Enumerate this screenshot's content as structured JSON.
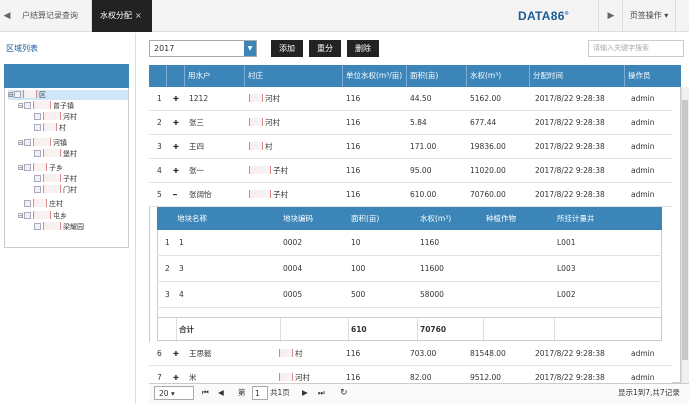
{
  "tabs": {
    "prev_arrow": "◀",
    "next_arrow": "▶",
    "items": [
      {
        "label": "户结算记录查询"
      },
      {
        "label": "水权分配",
        "close": "×"
      }
    ],
    "logo": "DATA86",
    "logo_mark": "®",
    "page_ops": "页签操作"
  },
  "left": {
    "title": "区域列表",
    "tree": [
      {
        "label": "区",
        "level": 0,
        "toggle": "⊟"
      },
      {
        "label": "曾子镇",
        "level": 1,
        "toggle": "⊟"
      },
      {
        "label": "河村",
        "level": 2,
        "toggle": ""
      },
      {
        "label": "村",
        "level": 2,
        "toggle": ""
      },
      {
        "label": "河镇",
        "level": 1,
        "toggle": "⊟"
      },
      {
        "label": "堡村",
        "level": 2,
        "toggle": ""
      },
      {
        "label": "子乡",
        "level": 1,
        "toggle": "⊟"
      },
      {
        "label": "子村",
        "level": 2,
        "toggle": ""
      },
      {
        "label": "门村",
        "level": 2,
        "toggle": ""
      },
      {
        "label": "庄村",
        "level": 1,
        "toggle": ""
      },
      {
        "label": "屯乡",
        "level": 1,
        "toggle": "⊟"
      },
      {
        "label": "梁耀园",
        "level": 2,
        "toggle": ""
      }
    ]
  },
  "toolbar": {
    "year": "2017",
    "add": "添加",
    "split": "重分",
    "delete": "删除",
    "search_placeholder": "请输入关键字搜索"
  },
  "grid": {
    "columns": [
      "用水户",
      "村庄",
      "单位水权(m³/亩)",
      "面积(亩)",
      "水权(m³)",
      "分配时间",
      "操作员"
    ],
    "rows": [
      {
        "no": "1",
        "exp": "✚",
        "user": "1212",
        "village": "河村",
        "unit": "116",
        "area": "44.50",
        "water": "5162.00",
        "time": "2017/8/22 9:28:38",
        "op": "admin"
      },
      {
        "no": "2",
        "exp": "✚",
        "user": "张三",
        "village": "河村",
        "unit": "116",
        "area": "5.84",
        "water": "677.44",
        "time": "2017/8/22 9:28:38",
        "op": "admin"
      },
      {
        "no": "3",
        "exp": "✚",
        "user": "王四",
        "village": "村",
        "unit": "116",
        "area": "171.00",
        "water": "19836.00",
        "time": "2017/8/22 9:28:38",
        "op": "admin"
      },
      {
        "no": "4",
        "exp": "✚",
        "user": "张一",
        "village": "子村",
        "unit": "116",
        "area": "95.00",
        "water": "11020.00",
        "time": "2017/8/22 9:28:38",
        "op": "admin"
      },
      {
        "no": "5",
        "exp": "━",
        "user": "张阔怡",
        "village": "子村",
        "unit": "116",
        "area": "610.00",
        "water": "70760.00",
        "time": "2017/8/22 9:28:38",
        "op": "admin"
      },
      {
        "no": "6",
        "exp": "✚",
        "user": "王思懿",
        "village": "村",
        "unit": "116",
        "area": "703.00",
        "water": "81548.00",
        "time": "2017/8/22 9:28:38",
        "op": "admin"
      },
      {
        "no": "7",
        "exp": "✚",
        "user": "米",
        "village": "河村",
        "unit": "116",
        "area": "82.00",
        "water": "9512.00",
        "time": "2017/8/22 9:28:38",
        "op": "admin"
      }
    ]
  },
  "detail": {
    "columns": [
      "地块名称",
      "地块编码",
      "面积(亩)",
      "水权(m³)",
      "种植作物",
      "所挂计量井"
    ],
    "rows": [
      {
        "no": "1",
        "name": "1",
        "code": "0002",
        "area": "10",
        "water": "1160",
        "crop": "",
        "well": "L001"
      },
      {
        "no": "2",
        "name": "3",
        "code": "0004",
        "area": "100",
        "water": "11600",
        "crop": "",
        "well": "L003"
      },
      {
        "no": "3",
        "name": "4",
        "code": "0005",
        "area": "500",
        "water": "58000",
        "crop": "",
        "well": "L002"
      }
    ],
    "total_label": "合计",
    "total_area": "610",
    "total_water": "70760"
  },
  "pager": {
    "page_size": "20",
    "page_label": "第",
    "page_value": "1",
    "of_pages": "共1页",
    "summary": "显示1到7,共7记录",
    "first": "⏮",
    "prev": "◀",
    "next": "▶",
    "last": "⏭",
    "refresh": "↻"
  }
}
